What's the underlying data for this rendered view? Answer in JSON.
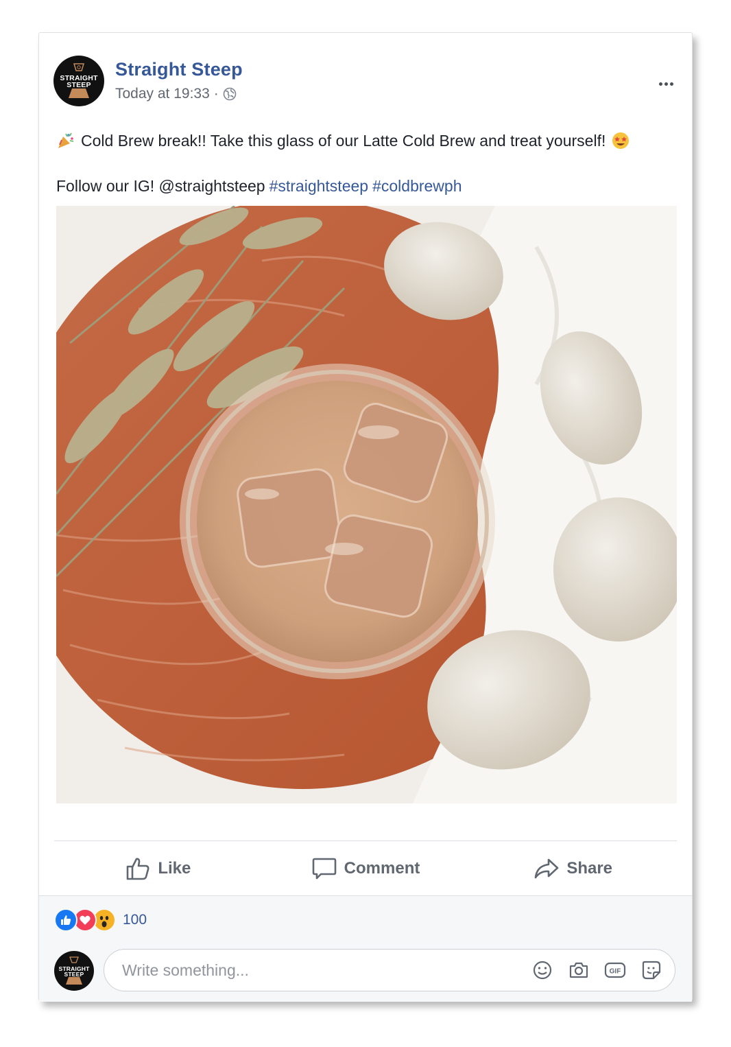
{
  "post": {
    "page_name": "Straight Steep",
    "avatar_text": "STRAIGHT\nSTEEP",
    "timestamp": "Today at 19:33",
    "separator": "·",
    "privacy_icon": "globe-icon",
    "more_icon": "more-options-icon",
    "text_line1": "Cold Brew break!! Take this glass of our Latte Cold Brew and treat yourself!",
    "text_line1_lead_emoji": "party-popper-emoji",
    "text_line1_trail_emoji": "star-struck-emoji",
    "text_line2_prefix": "Follow our IG! @straightsteep",
    "hashtags": [
      "#straightsteep",
      "#coldbrewph"
    ]
  },
  "actions": {
    "like_label": "Like",
    "comment_label": "Comment",
    "share_label": "Share"
  },
  "reactions": {
    "types": [
      "like",
      "love",
      "wow"
    ],
    "count": "100"
  },
  "comment_box": {
    "placeholder": "Write something...",
    "tools": [
      "emoji-icon",
      "camera-icon",
      "gif-icon",
      "sticker-icon"
    ]
  },
  "colors": {
    "link_blue": "#365899",
    "action_gray": "#606770",
    "footer_bg": "#f6f7f9",
    "like_blue": "#1877f2",
    "love_red": "#f33e58",
    "wow_yellow": "#f7b125"
  }
}
